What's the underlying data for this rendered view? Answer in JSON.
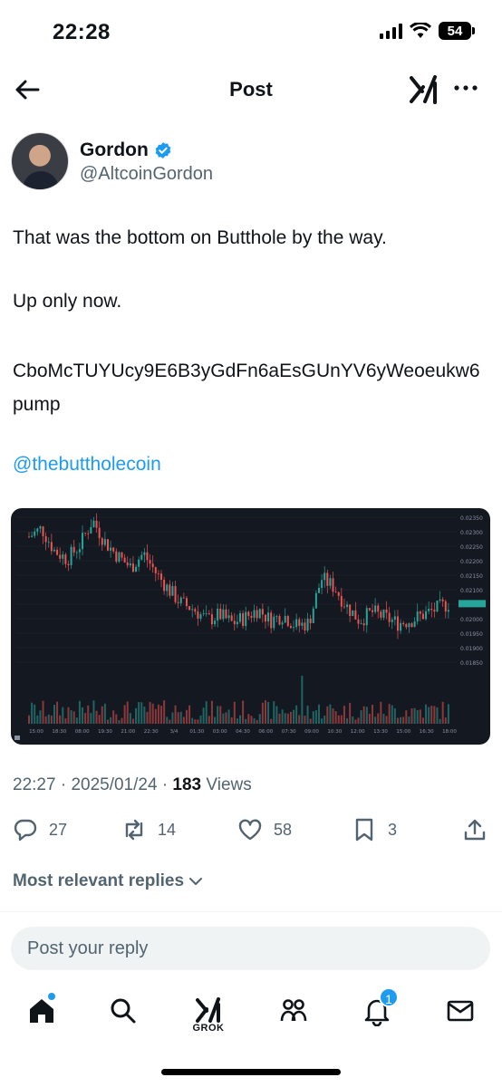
{
  "status_bar": {
    "time": "22:28",
    "battery": "54"
  },
  "header": {
    "title": "Post"
  },
  "author": {
    "name": "Gordon",
    "handle": "@AltcoinGordon"
  },
  "post": {
    "line1": "That was the bottom on Butthole by the way.",
    "line2": "Up only now.",
    "line3": "CboMcTUYUcy9E6B3yGdFn6aEsGUnYV6yWeoeukw6pump",
    "mention": "@thebuttholecoin"
  },
  "meta": {
    "time": "22:27",
    "date": "2025/01/24",
    "views_count": "183",
    "views_label": "Views"
  },
  "actions": {
    "replies": "27",
    "reposts": "14",
    "likes": "58",
    "bookmarks": "3"
  },
  "replies_filter": {
    "label": "Most relevant replies"
  },
  "reply_box": {
    "placeholder": "Post your reply"
  },
  "tabbar": {
    "grok_label": "GROK",
    "notifications_badge": "1"
  },
  "colors": {
    "accent": "#1d9bf0",
    "chart_bg": "#141821",
    "candle_up": "#26a69a",
    "candle_down": "#ef5350"
  },
  "chart_data": {
    "type": "candlestick",
    "y_ticks": [
      "0.02350",
      "0.02300",
      "0.02250",
      "0.02200",
      "0.02150",
      "0.02100",
      "0.02050",
      "0.02000",
      "0.01950",
      "0.01900",
      "0.01850"
    ],
    "x_ticks": [
      "15:00",
      "18:30",
      "08:00",
      "19:30",
      "21:00",
      "22:30",
      "3/4",
      "01:30",
      "03:00",
      "04:30",
      "06:00",
      "07:30",
      "09:00",
      "10:30",
      "12:00",
      "13:30",
      "15:00",
      "16:30",
      "18:00"
    ],
    "close_series": [
      0.0229,
      0.0232,
      0.0224,
      0.0221,
      0.0226,
      0.0235,
      0.0227,
      0.0222,
      0.0218,
      0.0223,
      0.0216,
      0.021,
      0.0205,
      0.0203,
      0.0199,
      0.0201,
      0.0198,
      0.02,
      0.0203,
      0.0199,
      0.0201,
      0.0197,
      0.0198,
      0.0214,
      0.0211,
      0.0204,
      0.0199,
      0.0202,
      0.02,
      0.0198,
      0.0199,
      0.0201,
      0.0203,
      0.0205
    ]
  }
}
